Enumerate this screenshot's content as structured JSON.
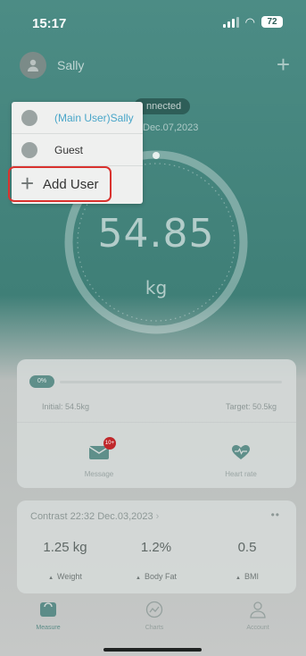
{
  "status_bar": {
    "time": "15:17",
    "battery": "72"
  },
  "header": {
    "user_name": "Sally"
  },
  "connection": {
    "status": "nnected",
    "date": "Dec.07,2023"
  },
  "weight": {
    "value": "54.85",
    "unit": "kg"
  },
  "user_menu": {
    "items": [
      {
        "label": "(Main User)Sally"
      },
      {
        "label": "Guest"
      }
    ],
    "add_label": "Add User"
  },
  "goal": {
    "initial": "Initial: 54.5kg",
    "target": "Target: 50.5kg"
  },
  "tiles": [
    {
      "label": "Message",
      "badge": "10+"
    },
    {
      "label": "Heart rate"
    }
  ],
  "contrast": {
    "title": "Contrast 22:32 Dec.03,2023",
    "metrics": [
      {
        "value": "1.25 kg",
        "label": "Weight"
      },
      {
        "value": "1.2%",
        "label": "Body Fat"
      },
      {
        "value": "0.5",
        "label": "BMI"
      }
    ]
  },
  "nav": {
    "items": [
      {
        "label": "Measure"
      },
      {
        "label": "Charts"
      },
      {
        "label": "Account"
      }
    ]
  },
  "colors": {
    "accent": "#4c8c85",
    "highlight": "#d9322e",
    "main_user_text": "#49a6c9"
  }
}
